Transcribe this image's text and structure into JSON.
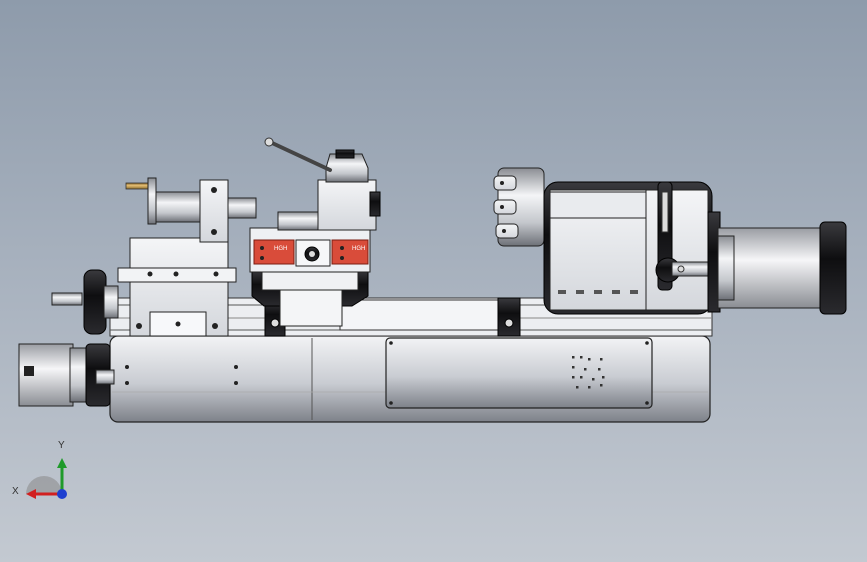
{
  "scene": {
    "model_name": "lathe-assembly",
    "rail_block_labels": [
      "HGH",
      "HGH"
    ]
  },
  "triad": {
    "x_label": "X",
    "y_label": "Y",
    "colors": {
      "x": "#d12020",
      "y": "#1f9a2a",
      "z": "#1e3fd0"
    }
  },
  "colors": {
    "background_top": "#8e9bab",
    "background_bottom": "#c3c9d1",
    "body_light": "#e4e6ea",
    "body_mid": "#b8bcc4",
    "body_dark": "#6c7078",
    "black_part": "#1c1c1e",
    "red_part": "#d94c3a"
  }
}
